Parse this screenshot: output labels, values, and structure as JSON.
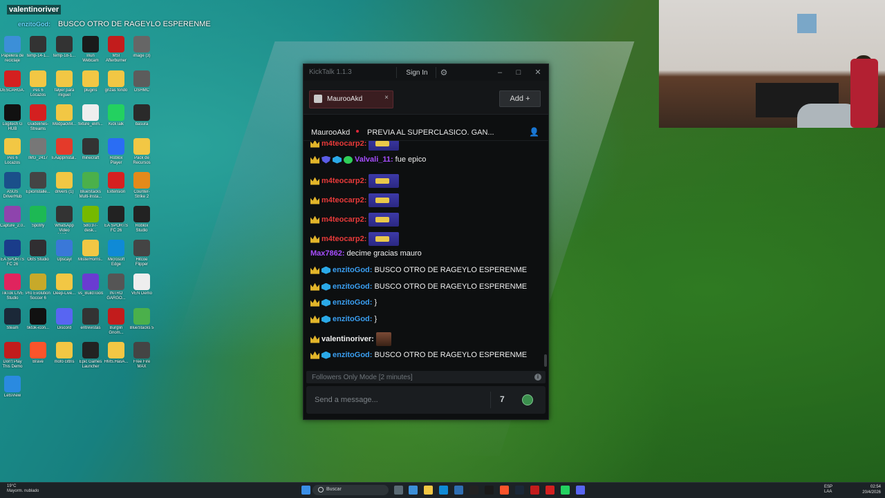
{
  "overlay": {
    "username": "valentinoriver",
    "sub_label": "enzitoGod:",
    "message": "BUSCO OTRO DE RAGEYLO ESPERENME"
  },
  "desktop_icons": [
    {
      "label": "Papelera de reciclaje",
      "color": "#3c8fd8"
    },
    {
      "label": "temp-14-1...",
      "color": "#333"
    },
    {
      "label": "temp-18-1...",
      "color": "#333"
    },
    {
      "label": "Iriun Webcam",
      "color": "#1a1a1a"
    },
    {
      "label": "MSI Afterburner",
      "color": "#c21c1c"
    },
    {
      "label": "image (3)",
      "color": "#666"
    },
    {
      "label": "DESCARGA...",
      "color": "#d42020"
    },
    {
      "label": "Pes 6 Locazos",
      "color": "#f2c744"
    },
    {
      "label": "falyer para miguel",
      "color": "#f2c744"
    },
    {
      "label": "plugins",
      "color": "#f2c744"
    },
    {
      "label": "grizas fondo",
      "color": "#f2c744"
    },
    {
      "label": "DSHMC",
      "color": "#5c5c5c"
    },
    {
      "label": "Logitech G HUB",
      "color": "#111"
    },
    {
      "label": "Guidelines-Streams",
      "color": "#d42020"
    },
    {
      "label": "ModpackM...",
      "color": "#f2c744"
    },
    {
      "label": "fixture_elim...",
      "color": "#eee"
    },
    {
      "label": "KickTalk",
      "color": "#23d160"
    },
    {
      "label": "basura",
      "color": "#2a2a2a"
    },
    {
      "label": "Pes 6 Locazos",
      "color": "#f2c744"
    },
    {
      "label": "IMG_2417",
      "color": "#777"
    },
    {
      "label": "EAappInstal...",
      "color": "#e43a2a"
    },
    {
      "label": "minecraft",
      "color": "#333"
    },
    {
      "label": "Roblox Player",
      "color": "#2a6df4"
    },
    {
      "label": "Pack de Recursos",
      "color": "#f2c744"
    },
    {
      "label": "ASUS DriverHub",
      "color": "#1a4f8a"
    },
    {
      "label": "Epicinstalle...",
      "color": "#444"
    },
    {
      "label": "drivers (1)",
      "color": "#f2c744"
    },
    {
      "label": "BlueStacks Multi-Insta...",
      "color": "#4bb04b"
    },
    {
      "label": "Extension",
      "color": "#d62020"
    },
    {
      "label": "Counter-Strike 2",
      "color": "#e48a1a"
    },
    {
      "label": "Capture_2.0...",
      "color": "#8e44ad"
    },
    {
      "label": "Spotify",
      "color": "#1db954"
    },
    {
      "label": "WhatsApp Video 2025-...",
      "color": "#333"
    },
    {
      "label": "580.97-desk...",
      "color": "#76b900"
    },
    {
      "label": "EA SPORTS FC 26",
      "color": "#222"
    },
    {
      "label": "Roblox Studio",
      "color": "#222"
    },
    {
      "label": "EA SPORTS FC 26",
      "color": "#1a3c8a"
    },
    {
      "label": "OBS Studio",
      "color": "#302e31"
    },
    {
      "label": "Upscayl",
      "color": "#3a78d8"
    },
    {
      "label": "MisterHorns...",
      "color": "#f2c744"
    },
    {
      "label": "Microsoft Edge",
      "color": "#0f8ad6"
    },
    {
      "label": "Hitcoe Flipper",
      "color": "#444"
    },
    {
      "label": "TikTok LIVE Studio",
      "color": "#e0245e"
    },
    {
      "label": "Pro Evolution Soccer 6",
      "color": "#c7a92a"
    },
    {
      "label": "Deep-Live...",
      "color": "#f2c744"
    },
    {
      "label": "vs_BuildTools",
      "color": "#6a3bd1"
    },
    {
      "label": "INTRO GARGO...",
      "color": "#555"
    },
    {
      "label": "VEN Demo",
      "color": "#eee"
    },
    {
      "label": "Steam",
      "color": "#1b2838"
    },
    {
      "label": "tiktok-icon...",
      "color": "#111"
    },
    {
      "label": "Discord",
      "color": "#5865f2"
    },
    {
      "label": "entrevistas",
      "color": "#333"
    },
    {
      "label": "Burglin Gnom...",
      "color": "#c21c1c"
    },
    {
      "label": "BlueStacks 5",
      "color": "#4bb04b"
    },
    {
      "label": "Don't Play This Demo",
      "color": "#c21c1c"
    },
    {
      "label": "Brave",
      "color": "#fb542b"
    },
    {
      "label": "mofo cittris",
      "color": "#f2c744"
    },
    {
      "label": "Epic Games Launcher",
      "color": "#222"
    },
    {
      "label": "HMS.HasA...",
      "color": "#f2c744"
    },
    {
      "label": "Free Fire MAX",
      "color": "#444"
    },
    {
      "label": "LetsView",
      "color": "#2a8ae0"
    }
  ],
  "kicktalk": {
    "app_title": "KickTalk 1.1.3",
    "signin_label": "Sign In",
    "tab": {
      "label": "MaurooAkd",
      "close": "×"
    },
    "add_label": "Add  +",
    "channel": {
      "name": "MaurooAkd",
      "title": "PREVIA AL SUPERCLASICO. GAN..."
    },
    "messages": [
      {
        "user": "m4teocarp2:",
        "color": "#e83a3a",
        "badges": [
          "crown"
        ],
        "text": "",
        "emote": "big"
      },
      {
        "user": "Valvali_11:",
        "color": "#a64dff",
        "badges": [
          "crown",
          "shield",
          "gem",
          "verified"
        ],
        "text": "fue epico",
        "emote": ""
      },
      {
        "user": "m4teocarp2:",
        "color": "#e83a3a",
        "badges": [
          "crown"
        ],
        "text": "",
        "emote": "big"
      },
      {
        "user": "m4teocarp2:",
        "color": "#e83a3a",
        "badges": [
          "crown"
        ],
        "text": "",
        "emote": "big"
      },
      {
        "user": "m4teocarp2:",
        "color": "#e83a3a",
        "badges": [
          "crown"
        ],
        "text": "",
        "emote": "big"
      },
      {
        "user": "m4teocarp2:",
        "color": "#e83a3a",
        "badges": [
          "crown"
        ],
        "text": "",
        "emote": "big"
      },
      {
        "user": "Max7862:",
        "color": "#a64dff",
        "badges": [],
        "text": "decime gracias mauro",
        "emote": ""
      },
      {
        "user": "enzitoGod:",
        "color": "#3a9ef0",
        "badges": [
          "crown",
          "gem"
        ],
        "text": "BUSCO OTRO DE RAGEYLO ESPERENME",
        "emote": ""
      },
      {
        "user": "enzitoGod:",
        "color": "#3a9ef0",
        "badges": [
          "crown",
          "gem"
        ],
        "text": "BUSCO OTRO DE RAGEYLO ESPERENME",
        "emote": ""
      },
      {
        "user": "enzitoGod:",
        "color": "#3a9ef0",
        "badges": [
          "crown",
          "gem"
        ],
        "text": "}",
        "emote": ""
      },
      {
        "user": "enzitoGod:",
        "color": "#3a9ef0",
        "badges": [
          "crown",
          "gem"
        ],
        "text": "}",
        "emote": ""
      },
      {
        "user": "valentinoriver:",
        "color": "#f0f0f0",
        "badges": [
          "crown"
        ],
        "text": "",
        "emote": "face"
      },
      {
        "user": "enzitoGod:",
        "color": "#3a9ef0",
        "badges": [
          "crown",
          "gem"
        ],
        "text": "BUSCO OTRO DE RAGEYLO ESPERENME",
        "emote": ""
      }
    ],
    "followers_notice": "Followers Only Mode [2 minutes]",
    "input_placeholder": "Send a message..."
  },
  "taskbar": {
    "weather_temp": "19°C",
    "weather_desc": "Mayorm. nublado",
    "search_label": "Buscar",
    "lang1": "ESP",
    "lang2": "LAA",
    "time": "02:54",
    "date": "20/4/2026"
  }
}
